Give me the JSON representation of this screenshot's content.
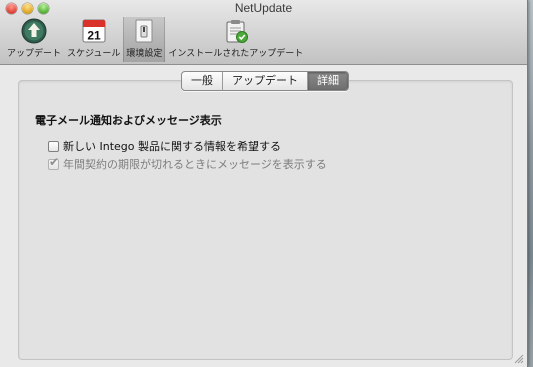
{
  "window": {
    "title": "NetUpdate"
  },
  "toolbar": {
    "items": [
      {
        "label": "アップデート",
        "icon": "update-arrow-icon"
      },
      {
        "label": "スケジュール",
        "icon": "calendar-icon",
        "calendar_day": "21"
      },
      {
        "label": "環境設定",
        "icon": "switch-icon",
        "selected": true
      },
      {
        "label": "インストールされたアップデート",
        "icon": "clipboard-check-icon"
      }
    ]
  },
  "tabs": [
    {
      "label": "一般",
      "active": false
    },
    {
      "label": "アップデート",
      "active": false
    },
    {
      "label": "詳細",
      "active": true
    }
  ],
  "section": {
    "title": "電子メール通知およびメッセージ表示",
    "options": [
      {
        "label": "新しい Intego 製品に関する情報を希望する",
        "checked": false,
        "enabled": true
      },
      {
        "label": "年間契約の期限が切れるときにメッセージを表示する",
        "checked": true,
        "enabled": false
      }
    ]
  },
  "colors": {
    "active_tab": "#7c7c7c",
    "window_bg": "#e9e9e9",
    "panel_bg": "#e2e2e2"
  }
}
